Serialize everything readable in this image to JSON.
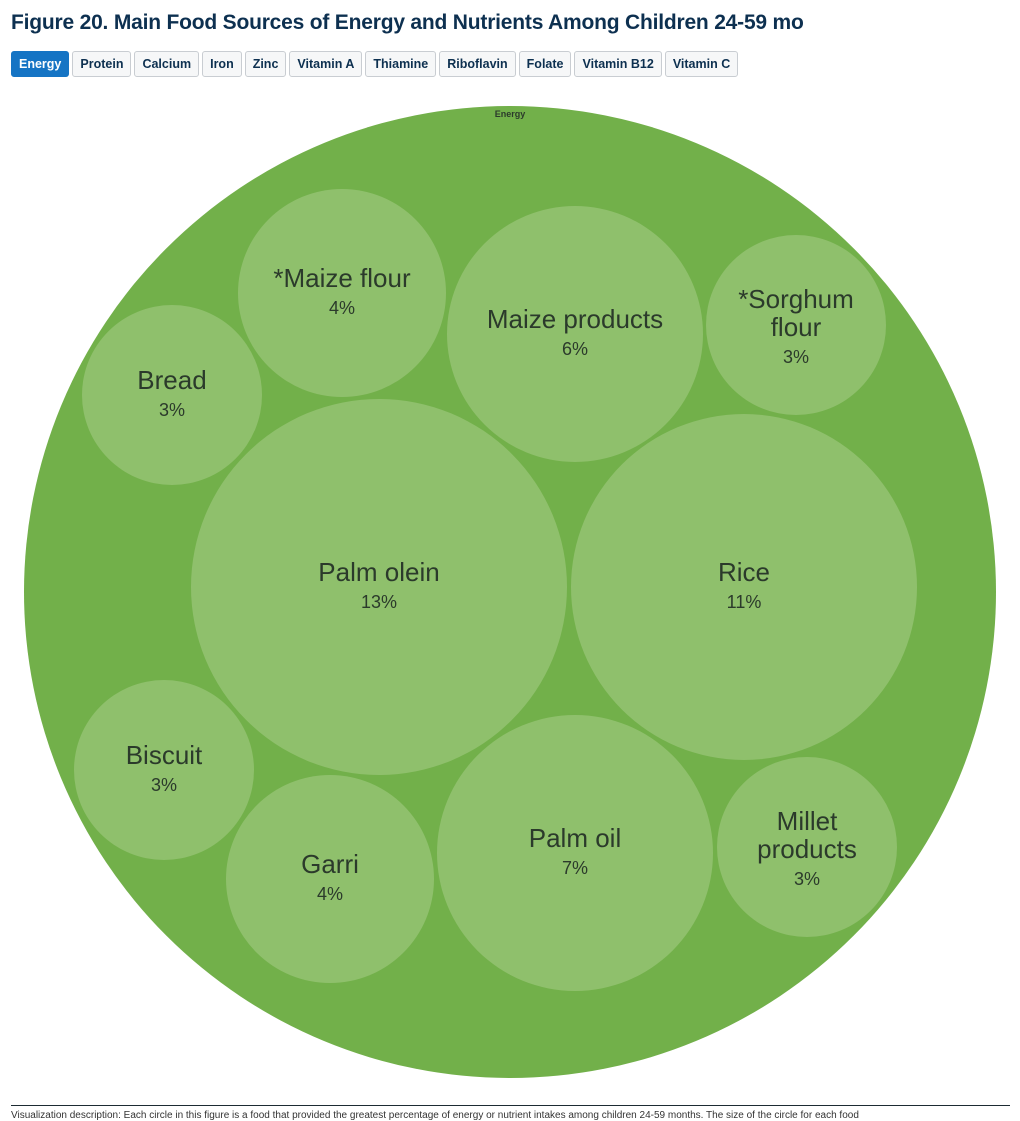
{
  "header": {
    "title": "Figure 20. Main Food Sources of Energy and Nutrients Among Children 24-59 mo"
  },
  "tabs": [
    {
      "label": "Energy",
      "active": true
    },
    {
      "label": "Protein",
      "active": false
    },
    {
      "label": "Calcium",
      "active": false
    },
    {
      "label": "Iron",
      "active": false
    },
    {
      "label": "Zinc",
      "active": false
    },
    {
      "label": "Vitamin A",
      "active": false
    },
    {
      "label": "Thiamine",
      "active": false
    },
    {
      "label": "Riboflavin",
      "active": false
    },
    {
      "label": "Folate",
      "active": false
    },
    {
      "label": "Vitamin B12",
      "active": false
    },
    {
      "label": "Vitamin C",
      "active": false
    }
  ],
  "colors": {
    "accent": "#1574c4",
    "outer_circle": "#72b04a",
    "inner_circle": "#8fc06c",
    "title": "#0d3050"
  },
  "chart_data": {
    "type": "bubble-pack",
    "title": "Figure 20. Main Food Sources of Energy and Nutrients Among Children 24-59 mo",
    "group": "Energy",
    "unit": "%",
    "items": [
      {
        "name": "Palm olein",
        "value": 13,
        "label_lines": [
          "Palm olein"
        ]
      },
      {
        "name": "Rice",
        "value": 11,
        "label_lines": [
          "Rice"
        ]
      },
      {
        "name": "Palm oil",
        "value": 7,
        "label_lines": [
          "Palm oil"
        ]
      },
      {
        "name": "Maize products",
        "value": 6,
        "label_lines": [
          "Maize products"
        ]
      },
      {
        "name": "*Maize flour",
        "value": 4,
        "label_lines": [
          "*Maize flour"
        ]
      },
      {
        "name": "Garri",
        "value": 4,
        "label_lines": [
          "Garri"
        ]
      },
      {
        "name": "*Sorghum flour",
        "value": 3,
        "label_lines": [
          "*Sorghum",
          "flour"
        ]
      },
      {
        "name": "Bread",
        "value": 3,
        "label_lines": [
          "Bread"
        ]
      },
      {
        "name": "Biscuit",
        "value": 3,
        "label_lines": [
          "Biscuit"
        ]
      },
      {
        "name": "Millet products",
        "value": 3,
        "label_lines": [
          "Millet",
          "products"
        ]
      }
    ]
  },
  "footer": {
    "description": "Visualization description: Each circle in this figure is a food that provided the greatest percentage of energy or nutrient intakes among children 24-59 months. The size of the circle for each food"
  }
}
